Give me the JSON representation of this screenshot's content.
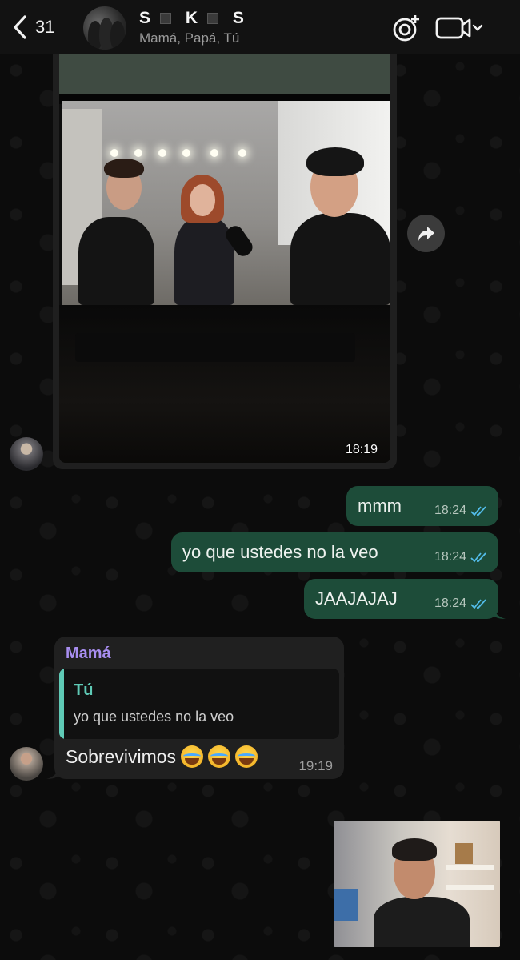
{
  "header": {
    "back_count": "31",
    "title_letters": [
      "S",
      "K",
      "S"
    ],
    "subtitle": "Mamá, Papá, Tú"
  },
  "messages": {
    "image_time": "18:19",
    "outgoing": [
      {
        "text": "mmm",
        "time": "18:24"
      },
      {
        "text": "yo que ustedes no la veo",
        "time": "18:24"
      },
      {
        "text": "JAAJAJAJ",
        "time": "18:24"
      }
    ],
    "incoming_reply": {
      "sender": "Mamá",
      "quoted_sender": "Tú",
      "quoted_text": "yo que ustedes no la veo",
      "text": "Sobrevivimos",
      "emoji_count": 3,
      "time": "19:19"
    }
  },
  "colors": {
    "outgoing_bubble": "#1d4c39",
    "incoming_bubble": "#202020",
    "sender_name": "#a88ef0",
    "quote_accent": "#5fcab6",
    "read_ticks": "#53bdeb"
  },
  "icons": [
    "chevron-left-icon",
    "camera-lens-icon",
    "video-camera-icon",
    "chevron-down-icon",
    "forward-icon",
    "double-check-icon"
  ]
}
